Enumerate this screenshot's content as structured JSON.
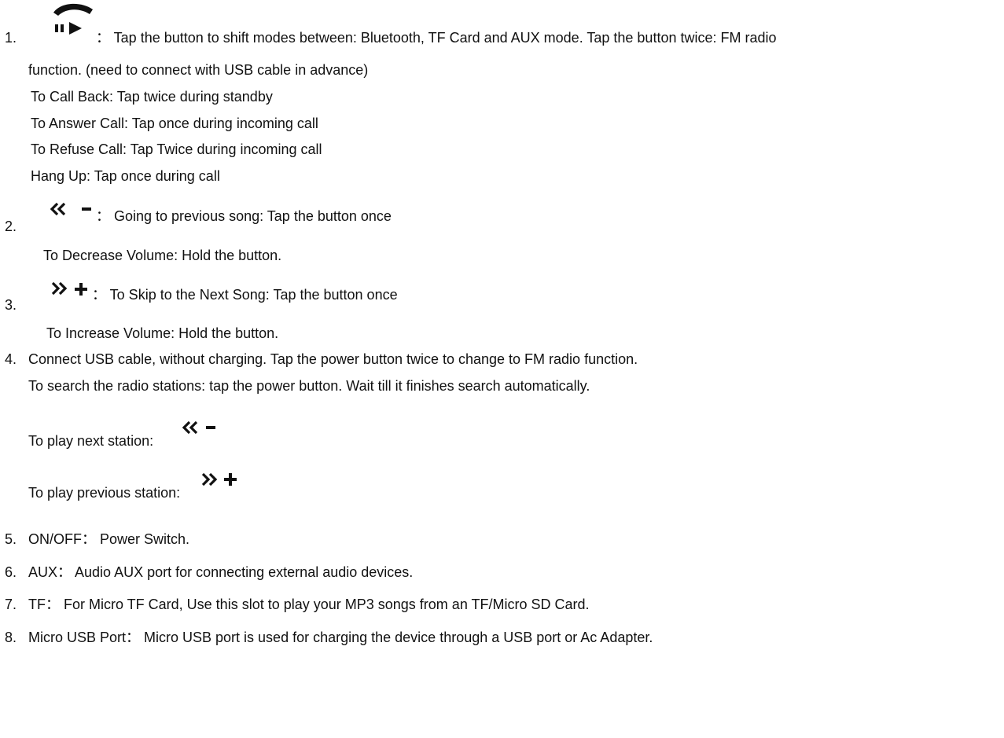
{
  "items": [
    {
      "number": "1.",
      "icons": [
        "phone-play-pause-icon"
      ],
      "text": "： Tap the button to shift modes between: Bluetooth, TF Card and AUX mode. Tap the button twice: FM radio",
      "continuation": "function. (need to connect with USB cable in advance)",
      "sub": [
        "To Call Back: Tap twice during standby",
        "To Answer Call: Tap once during incoming call",
        "To Refuse Call: Tap Twice during incoming call",
        "Hang Up: Tap once during call"
      ]
    },
    {
      "number": "2.",
      "icons": [
        "rewind-icon",
        "minus-icon"
      ],
      "text": "： Going to previous song: Tap the button once",
      "sub": [
        "To Decrease Volume: Hold the button."
      ]
    },
    {
      "number": "3.",
      "icons": [
        "fast-forward-icon",
        "plus-icon"
      ],
      "text": "： To Skip to the Next Song: Tap the button once",
      "sub": [
        "To Increase Volume: Hold the button."
      ]
    },
    {
      "number": "4.",
      "text": "Connect USB cable, without charging. Tap the power button twice to change to FM radio function.",
      "sub": [
        "To search the radio stations: tap the power button. Wait till it finishes search automatically.",
        "To play next station:",
        "To play previous station:"
      ]
    },
    {
      "number": "5.",
      "text": "ON/OFF： Power Switch."
    },
    {
      "number": "6.",
      "text": "AUX： Audio AUX port for connecting external audio devices."
    },
    {
      "number": "7.",
      "text": "TF： For Micro TF Card, Use this slot to play your MP3 songs from an TF/Micro SD Card."
    },
    {
      "number": "8.",
      "text": "Micro USB Port： Micro USB port is used for charging the device through a USB port or Ac Adapter."
    }
  ]
}
